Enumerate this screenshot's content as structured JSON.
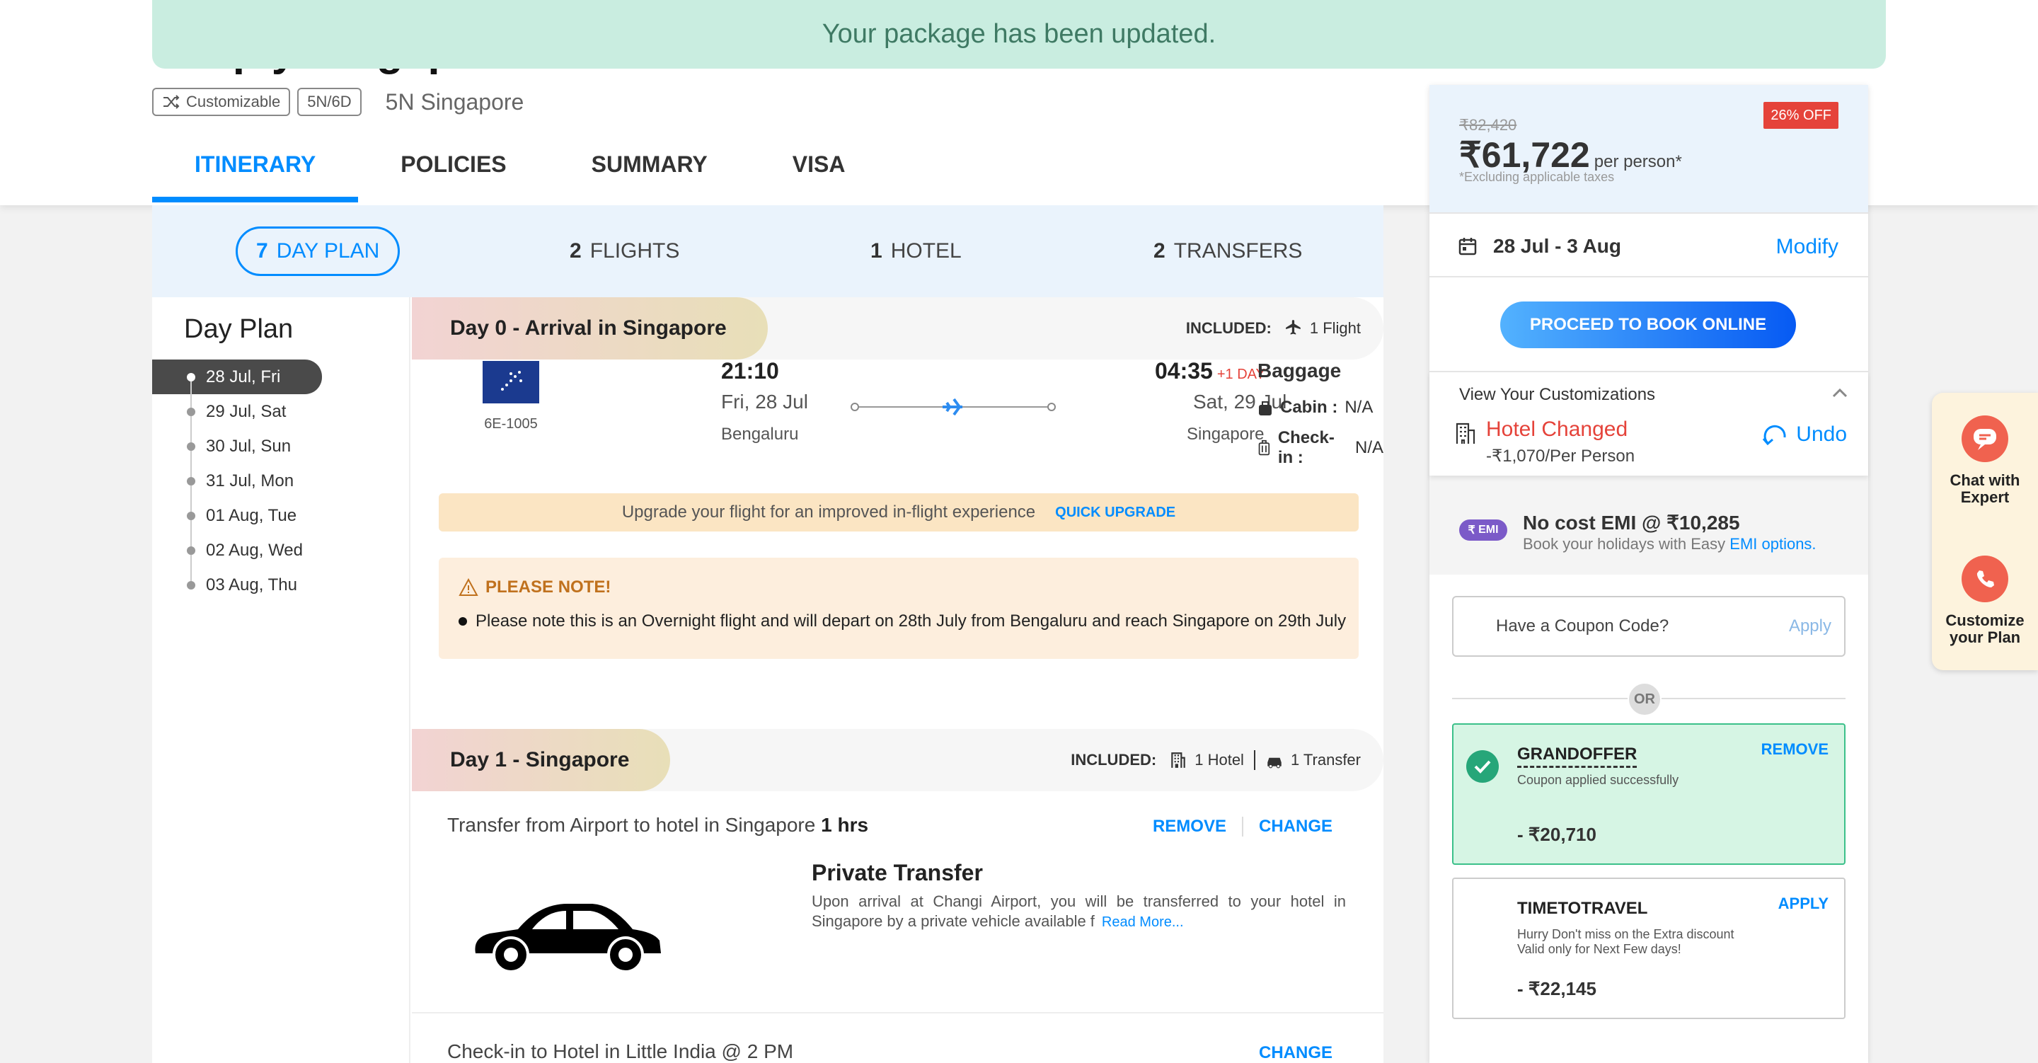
{
  "toast": "Your package has been updated.",
  "package": {
    "title": "Simply Singapore",
    "chips": [
      "Customizable",
      "5N/6D"
    ],
    "destination": "5N Singapore"
  },
  "tabs": [
    "ITINERARY",
    "POLICIES",
    "SUMMARY",
    "VISA"
  ],
  "subtabs": [
    {
      "count": "7",
      "label": "DAY PLAN"
    },
    {
      "count": "2",
      "label": "FLIGHTS"
    },
    {
      "count": "1",
      "label": "HOTEL"
    },
    {
      "count": "2",
      "label": "TRANSFERS"
    }
  ],
  "dayplan": {
    "title": "Day Plan",
    "days": [
      "28 Jul, Fri",
      "29 Jul, Sat",
      "30 Jul, Sun",
      "31 Jul, Mon",
      "01 Aug, Tue",
      "02 Aug, Wed",
      "03 Aug, Thu"
    ]
  },
  "day0": {
    "label": "Day 0 - Arrival in Singapore",
    "included_label": "INCLUDED:",
    "included_flight": "1 Flight",
    "flight": {
      "code": "6E-1005",
      "dep_time": "21:10",
      "dep_date": "Fri, 28 Jul",
      "dep_city": "Bengaluru",
      "arr_time": "04:35",
      "plus_day": "+1 DAY",
      "arr_date": "Sat, 29 Jul",
      "arr_city": "Singapore",
      "baggage_title": "Baggage",
      "cabin_label": "Cabin :",
      "cabin_value": "N/A",
      "checkin_label": "Check-in :",
      "checkin_value": "N/A"
    },
    "upgrade_text": "Upgrade your flight for an improved in-flight experience",
    "upgrade_link": "QUICK UPGRADE",
    "note_title": "PLEASE NOTE!",
    "note_text": "Please note this is an Overnight flight and will depart on 28th July from Bengaluru and reach Singapore on 29th July"
  },
  "day1": {
    "label": "Day 1 - Singapore",
    "included_label": "INCLUDED:",
    "included_hotel": "1 Hotel",
    "included_transfer": "1 Transfer",
    "transfer_text": "Transfer from Airport to hotel in Singapore",
    "transfer_duration": "1 hrs",
    "remove": "REMOVE",
    "change": "CHANGE",
    "pt_title": "Private Transfer",
    "pt_desc": "Upon arrival at Changi Airport, you will be transferred to your hotel in Singapore by a private vehicle available f",
    "read_more": "Read More...",
    "checkin_text": "Check-in to Hotel in Little India @ 2 PM",
    "checkin_change": "CHANGE"
  },
  "panel": {
    "original_price": "₹82,420",
    "price": "₹61,722",
    "per_person": "per person*",
    "taxes": "*Excluding applicable taxes",
    "discount": "26% OFF",
    "dates": "28 Jul - 3 Aug",
    "modify": "Modify",
    "book_button": "PROCEED TO BOOK ONLINE",
    "customizations_title": "View Your Customizations",
    "hotel_changed": "Hotel Changed",
    "hotel_changed_price": "-₹1,070/Per Person",
    "undo": "Undo",
    "emi_badge": "EMI",
    "emi_title": "No cost EMI @ ₹10,285",
    "emi_sub": "Book your holidays with Easy",
    "emi_link": "EMI options.",
    "coupon_placeholder": "Have a Coupon Code?",
    "coupon_apply": "Apply",
    "or": "OR",
    "coupons": [
      {
        "code": "GRANDOFFER",
        "desc": "Coupon applied successfully",
        "amount": "- ₹20,710",
        "action": "REMOVE"
      },
      {
        "code": "TIMETOTRAVEL",
        "desc_1": "Hurry Don't miss on the Extra discount",
        "desc_2": "Valid only for Next Few days!",
        "amount": "- ₹22,145",
        "action": "APPLY"
      }
    ]
  },
  "float": {
    "chat_line1": "Chat with",
    "chat_line2": "Expert",
    "custom_line1": "Customize",
    "custom_line2": "your Plan"
  },
  "colors": {
    "accent": "#008cff",
    "toast_bg": "#c9ede0",
    "discount_red": "#e5433a",
    "applied_green": "#d6f5e4"
  }
}
